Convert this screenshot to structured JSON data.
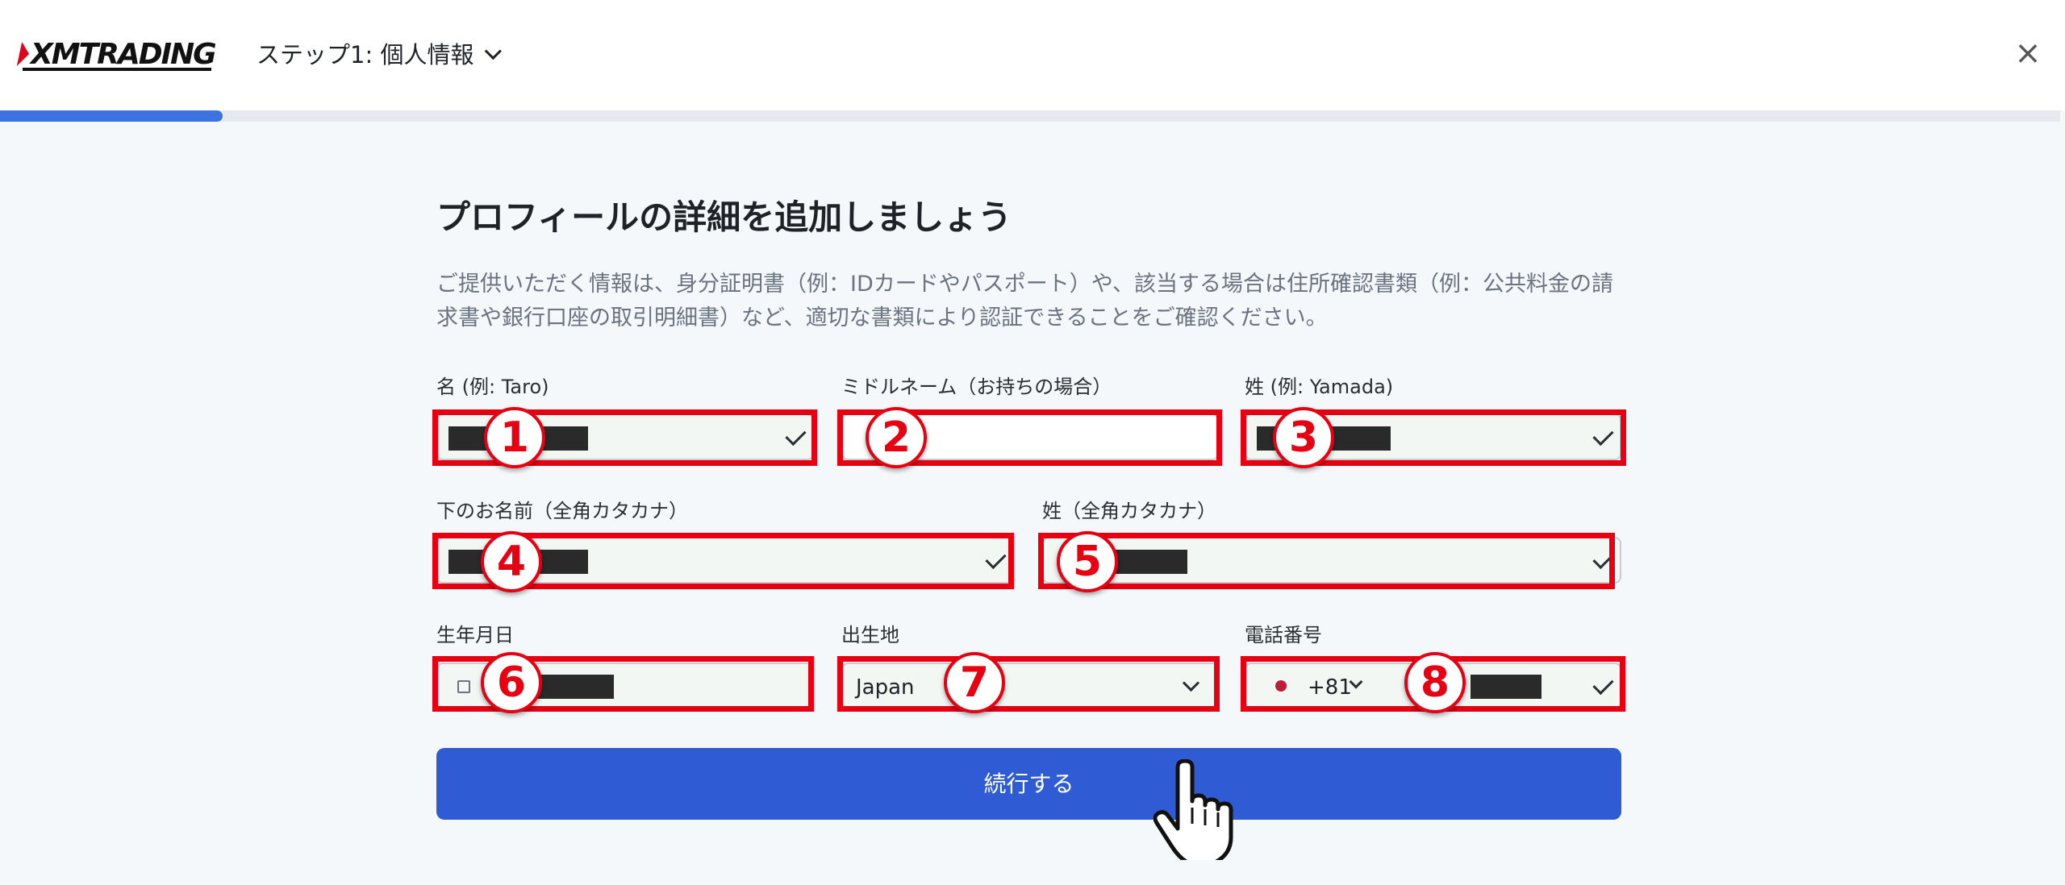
{
  "header": {
    "logo_text": "XMTRADING",
    "step_label": "ステップ1: 個人情報",
    "close_glyph": "×"
  },
  "progress": {
    "fraction": 0.108
  },
  "main": {
    "title": "プロフィールの詳細を追加しましょう",
    "description": "ご提供いただく情報は、身分証明書（例：IDカードやパスポート）や、該当する場合は住所確認書類（例：公共料金の請求書や銀行口座の取引明細書）など、適切な書類により認証できることをご確認ください。"
  },
  "fields": {
    "first_name": {
      "label": "名 (例: Taro)",
      "badge": "1"
    },
    "middle_name": {
      "label": "ミドルネーム（お持ちの場合）",
      "badge": "2"
    },
    "last_name": {
      "label": "姓 (例: Yamada)",
      "badge": "3"
    },
    "first_name_kana": {
      "label": "下のお名前（全角カタカナ）",
      "badge": "4"
    },
    "last_name_kana": {
      "label": "姓（全角カタカナ）",
      "badge": "5"
    },
    "birth_date": {
      "label": "生年月日",
      "badge": "6"
    },
    "birth_place": {
      "label": "出生地",
      "value": "Japan",
      "badge": "7"
    },
    "phone": {
      "label": "電話番号",
      "country_code": "+81",
      "badge": "8"
    }
  },
  "submit_label": "続行する",
  "colors": {
    "accent": "#2f5bd5",
    "annotation": "#e60012",
    "progress": "#3b74e0"
  },
  "icons": [
    "check-icon",
    "chevron-down-icon",
    "close-icon",
    "calendar-icon",
    "japan-flag-icon",
    "pointer-hand-icon"
  ]
}
